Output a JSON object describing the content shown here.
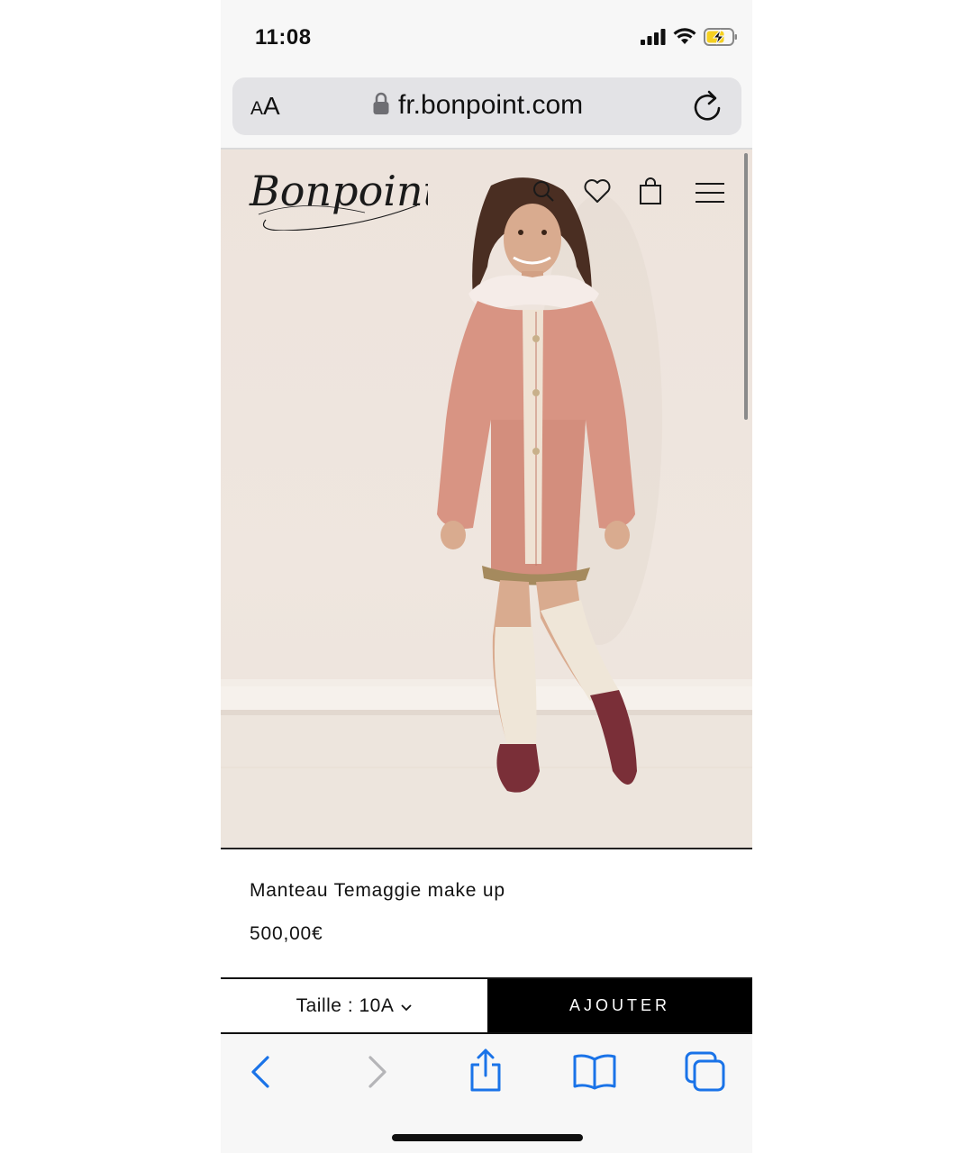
{
  "status_bar": {
    "time": "11:08",
    "icons": [
      "cellular-signal-icon",
      "wifi-icon",
      "battery-charging-icon"
    ]
  },
  "url_bar": {
    "text_size_label_small": "A",
    "text_size_label_large": "A",
    "url": "fr.bonpoint.com",
    "icons": [
      "lock-icon",
      "reload-icon"
    ]
  },
  "site_header": {
    "logo_text": "Bonpoint",
    "icons": [
      "search-icon",
      "heart-icon",
      "bag-icon",
      "menu-icon"
    ]
  },
  "product": {
    "name": "Manteau Temaggie make up",
    "price": "500,00€",
    "size_label": "Taille : 10A",
    "add_button_label": "AJOUTER"
  },
  "toolbar": {
    "icons": [
      "back-icon",
      "forward-icon",
      "share-icon",
      "bookmarks-icon",
      "tabs-icon"
    ]
  },
  "colors": {
    "accent_blue": "#1a73e8",
    "add_button_bg": "#000000",
    "battery_yellow": "#f5d020"
  }
}
